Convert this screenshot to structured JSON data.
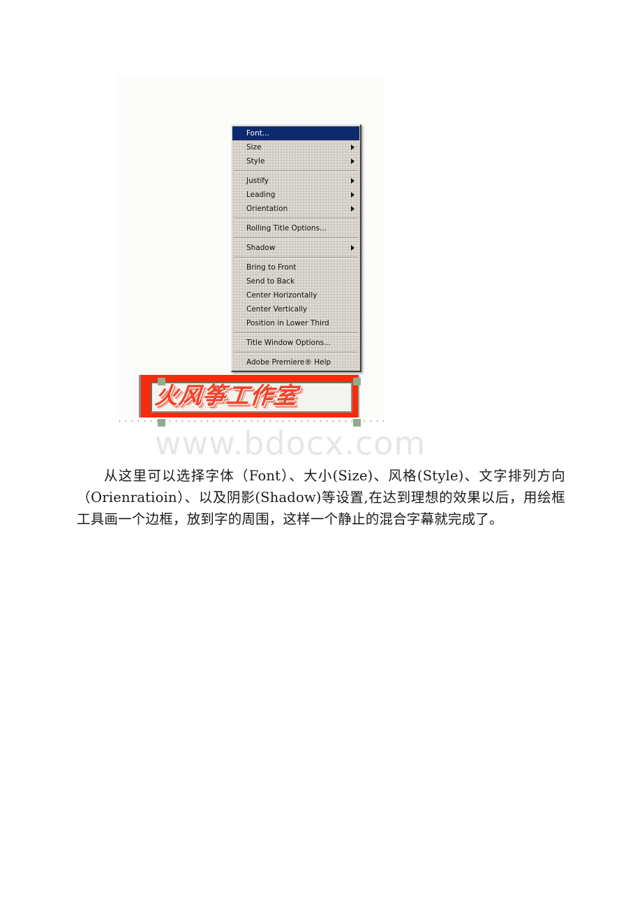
{
  "figure": {
    "canvas_background": "#fcfdfa",
    "title_object": {
      "box_color": "#f52b0c",
      "text": "火风筝工作室",
      "text_color": "#f0442a",
      "handle_color": "#93ac8c"
    }
  },
  "context_menu": {
    "highlight_color": "#0e2a6e",
    "background_color": "#d4d0c8",
    "items": [
      {
        "label": "Font...",
        "submenu": false,
        "highlighted": true
      },
      {
        "label": "Size",
        "submenu": true,
        "highlighted": false
      },
      {
        "label": "Style",
        "submenu": true,
        "highlighted": false
      },
      {
        "separator": true
      },
      {
        "label": "Justify",
        "submenu": true,
        "highlighted": false
      },
      {
        "label": "Leading",
        "submenu": true,
        "highlighted": false
      },
      {
        "label": "Orientation",
        "submenu": true,
        "highlighted": false
      },
      {
        "separator": true
      },
      {
        "label": "Rolling Title Options...",
        "submenu": false,
        "highlighted": false
      },
      {
        "separator": true
      },
      {
        "label": "Shadow",
        "submenu": true,
        "highlighted": false
      },
      {
        "separator": true
      },
      {
        "label": "Bring to Front",
        "submenu": false,
        "highlighted": false
      },
      {
        "label": "Send to Back",
        "submenu": false,
        "highlighted": false
      },
      {
        "label": "Center Horizontally",
        "submenu": false,
        "highlighted": false
      },
      {
        "label": "Center Vertically",
        "submenu": false,
        "highlighted": false
      },
      {
        "label": "Position in Lower Third",
        "submenu": false,
        "highlighted": false
      },
      {
        "separator": true
      },
      {
        "label": "Title Window Options...",
        "submenu": false,
        "highlighted": false
      },
      {
        "separator": true
      },
      {
        "label": "Adobe Premiere® Help",
        "submenu": false,
        "highlighted": false
      }
    ]
  },
  "watermark": {
    "text": "www.bdocx.com",
    "color": "#e6e6e6"
  },
  "document": {
    "paragraph": "从这里可以选择字体（Font）、大小(Size)、风格(Style)、文字排列方向（Orienratioin）、以及阴影(Shadow)等设置,在达到理想的效果以后，用绘框工具画一个边框，放到字的周围，这样一个静止的混合字幕就完成了。"
  }
}
